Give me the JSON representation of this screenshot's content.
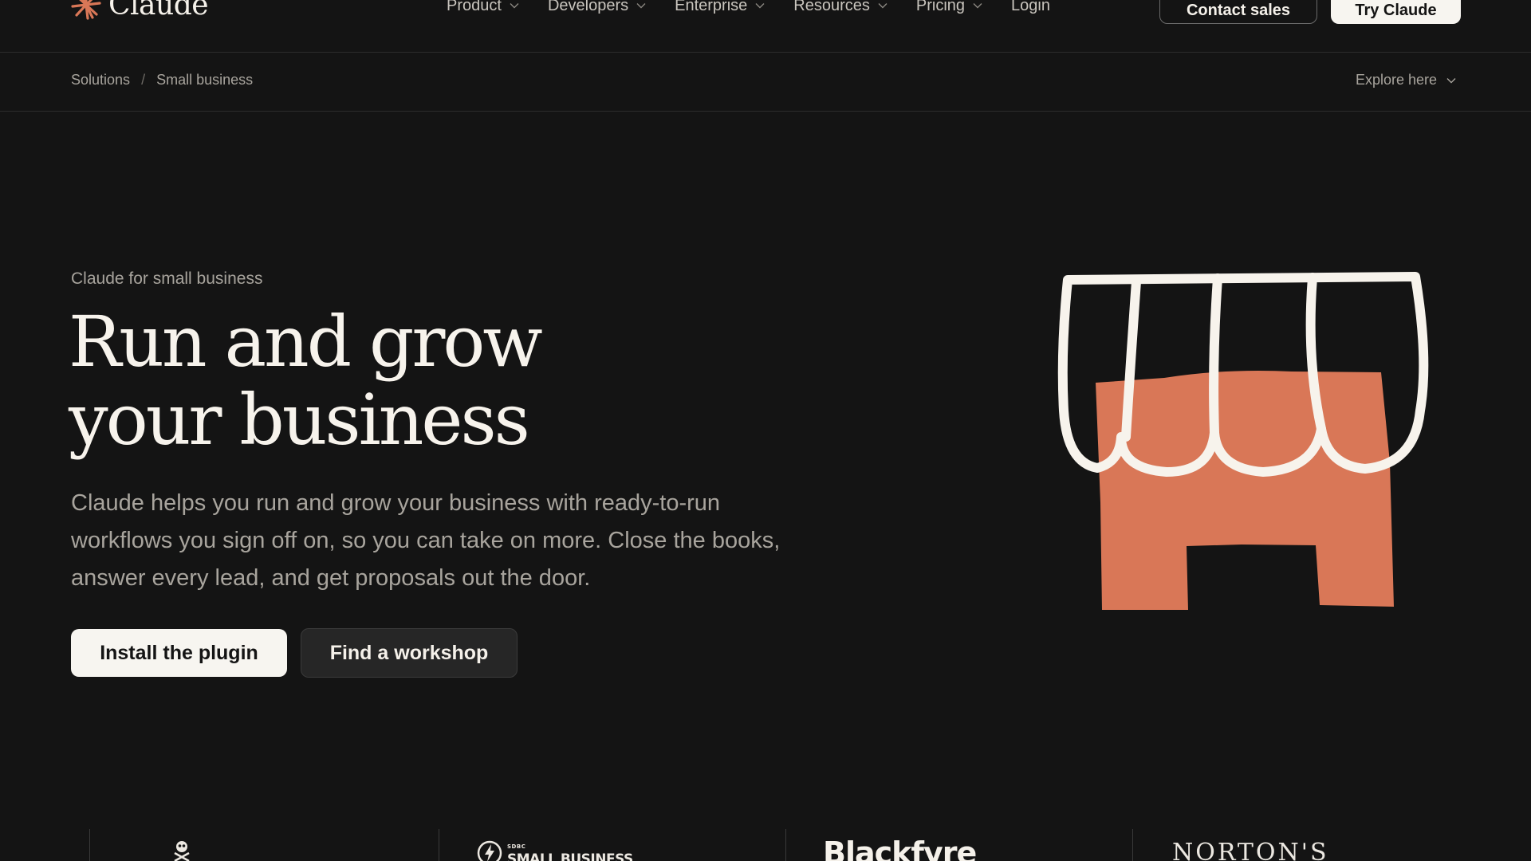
{
  "brand": {
    "name": "Claude",
    "accent": "#d97757"
  },
  "nav": {
    "items": [
      {
        "label": "Product",
        "has_menu": true
      },
      {
        "label": "Developers",
        "has_menu": true
      },
      {
        "label": "Enterprise",
        "has_menu": true
      },
      {
        "label": "Resources",
        "has_menu": true
      },
      {
        "label": "Pricing",
        "has_menu": true
      },
      {
        "label": "Login",
        "has_menu": false
      }
    ],
    "contact_label": "Contact sales",
    "try_label": "Try Claude"
  },
  "breadcrumb": {
    "items": [
      "Solutions",
      "Small business"
    ],
    "separator": "/",
    "explore_label": "Explore here"
  },
  "hero": {
    "eyebrow": "Claude for small business",
    "title_line1": "Run and grow",
    "title_line2": "your business",
    "description": "Claude helps you run and grow your business with ready-to-run workflows you sign off on, so you can take on more. Close the books, answer every lead, and get proposals out the door.",
    "primary_label": "Install the plugin",
    "secondary_label": "Find a workshop"
  },
  "illustration": {
    "icon": "storefront-icon",
    "fill_color": "#d97757",
    "stroke_color": "#f7f3ec"
  },
  "client_logos": {
    "sbiz_small": "SDBC",
    "sbiz_main": "SMALL BUSINESS",
    "blackfyre": "Blackfyre",
    "nortons": "NORTON'S"
  }
}
